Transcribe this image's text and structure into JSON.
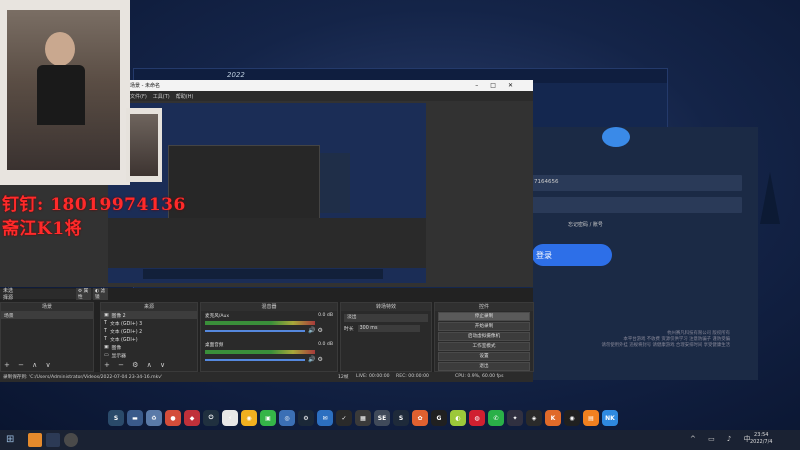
{
  "overlay": {
    "phone_line": "钉钉: 18019974136",
    "channel_line": "斋江K1将"
  },
  "login_window": {
    "title": "2022",
    "phone_value": "7164656",
    "forgot_password": "忘记密码 / 账号",
    "login_button": "登录",
    "footer_line1": "杭州赛凡科技有限公司 版权所有",
    "footer_line2": "本平台游戏 不收费 资源仅供学习 注意防骗子 谨防受骗",
    "footer_line3": "请勿使用外挂 违规将封号 请健康游戏 合理安排时间 享受健康生活"
  },
  "obs": {
    "title": "场景 - 未命名",
    "menu": [
      "文件(F)",
      "工具(T)",
      "帮助(H)"
    ],
    "scene_label": "未选择源",
    "props_label": "属性",
    "filters_label": "滤镜",
    "panels": {
      "scenes": "场景",
      "sources": "来源",
      "mixer": "混音器",
      "transitions": "转场特效",
      "controls": "控件"
    },
    "scenes": [
      "场景"
    ],
    "sources": [
      "图像 2",
      "文本 (GDI+) 3",
      "文本 (GDI+) 2",
      "文本 (GDI+)",
      "图像",
      "显示器"
    ],
    "mixer": [
      {
        "name": "麦克风/Aux",
        "db": "0.0 dB"
      },
      {
        "name": "桌面音频",
        "db": "0.0 dB"
      }
    ],
    "transition": {
      "type": "淡出",
      "duration_label": "时长",
      "duration_value": "300 ms"
    },
    "controls": [
      "停止录制",
      "开始录制",
      "启动虚拟摄像机",
      "工作室模式",
      "设置",
      "退出"
    ],
    "status": {
      "recording_path": "录制保存到: 'C:/Users/Administrator/Videos/2022-07-04 23-34-16.mkv'",
      "live": "LIVE: 00:00:00",
      "rec": "REC: 00:00:00",
      "cpu": "CPU: 0.9%, 60.00 fps",
      "dropped": "12帧"
    }
  },
  "taskbar": {
    "time": "23:54",
    "date": "2022/7/4"
  },
  "dock_icons": [
    {
      "name": "steam-icon",
      "color": "#2a4a6a",
      "glyph": "S"
    },
    {
      "name": "terminal-icon",
      "color": "#3a5a8a",
      "glyph": "▬"
    },
    {
      "name": "recycle-bin-icon",
      "color": "#5a7aa8",
      "glyph": "♻"
    },
    {
      "name": "chrome-icon",
      "color": "#d44d3a",
      "glyph": "●"
    },
    {
      "name": "game-controller-icon",
      "color": "#c0303a",
      "glyph": "◆"
    },
    {
      "name": "power-icon",
      "color": "#20303f",
      "glyph": "⏻"
    },
    {
      "name": "lightning-icon",
      "color": "#e8e8e8",
      "glyph": "⚡"
    },
    {
      "name": "owl-icon",
      "color": "#f0b020",
      "glyph": "◉"
    },
    {
      "name": "dice-icon",
      "color": "#35b548",
      "glyph": "▣"
    },
    {
      "name": "globe-icon",
      "color": "#3b6fb5",
      "glyph": "◎"
    },
    {
      "name": "steam-client-icon",
      "color": "#1b2838",
      "glyph": "⚙"
    },
    {
      "name": "mail-icon",
      "color": "#2c6fc0",
      "glyph": "✉"
    },
    {
      "name": "nvidia-check-icon",
      "color": "#2a2a2a",
      "glyph": "✓"
    },
    {
      "name": "app-icon",
      "color": "#3a3a3a",
      "glyph": "▦"
    },
    {
      "name": "se-icon",
      "color": "#404a5a",
      "glyph": "SE"
    },
    {
      "name": "s-app-icon",
      "color": "#1e2a3a",
      "glyph": "S"
    },
    {
      "name": "settings-icon",
      "color": "#e06030",
      "glyph": "✿"
    },
    {
      "name": "game-icon",
      "color": "#202020",
      "glyph": "G"
    },
    {
      "name": "lime-icon",
      "color": "#9cc83a",
      "glyph": "◐"
    },
    {
      "name": "netease-icon",
      "color": "#d02030",
      "glyph": "◍"
    },
    {
      "name": "wechat-icon",
      "color": "#2ab048",
      "glyph": "✆"
    },
    {
      "name": "badge-icon",
      "color": "#303040",
      "glyph": "✦"
    },
    {
      "name": "nvidia-icon",
      "color": "#2a2a2a",
      "glyph": "◈"
    },
    {
      "name": "orange-app-icon",
      "color": "#e06a2a",
      "glyph": "K"
    },
    {
      "name": "obs-icon",
      "color": "#202020",
      "glyph": "◉"
    },
    {
      "name": "orange-square-icon",
      "color": "#f08020",
      "glyph": "▤"
    },
    {
      "name": "nk-icon",
      "color": "#2f8ae0",
      "glyph": "NK"
    }
  ]
}
